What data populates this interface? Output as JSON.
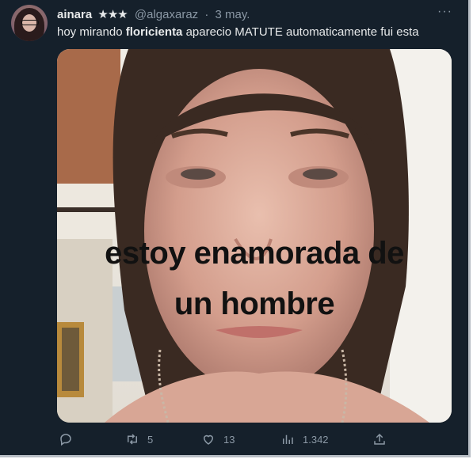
{
  "tweet": {
    "author_name": "ainara",
    "author_badge": "★★★",
    "handle": "@algaxaraz",
    "separator": "·",
    "date": "3 may.",
    "more_icon": "more-horizontal-icon",
    "more_label": "···",
    "text_before": "hoy mirando ",
    "text_bold": "floricienta",
    "text_after": " aparecio MATUTE automaticamente fui esta"
  },
  "media": {
    "caption_line1": "estoy enamorada de",
    "caption_line2": "un hombre"
  },
  "actions": {
    "reply": {
      "icon": "reply-icon",
      "count": ""
    },
    "retweet": {
      "icon": "retweet-icon",
      "count": "5"
    },
    "like": {
      "icon": "heart-icon",
      "count": "13"
    },
    "views": {
      "icon": "views-icon",
      "count": "1.342"
    },
    "share": {
      "icon": "share-icon",
      "count": ""
    }
  },
  "colors": {
    "background": "#15202b",
    "primary_text": "#e7e9ea",
    "secondary_text": "#8b98a5"
  }
}
